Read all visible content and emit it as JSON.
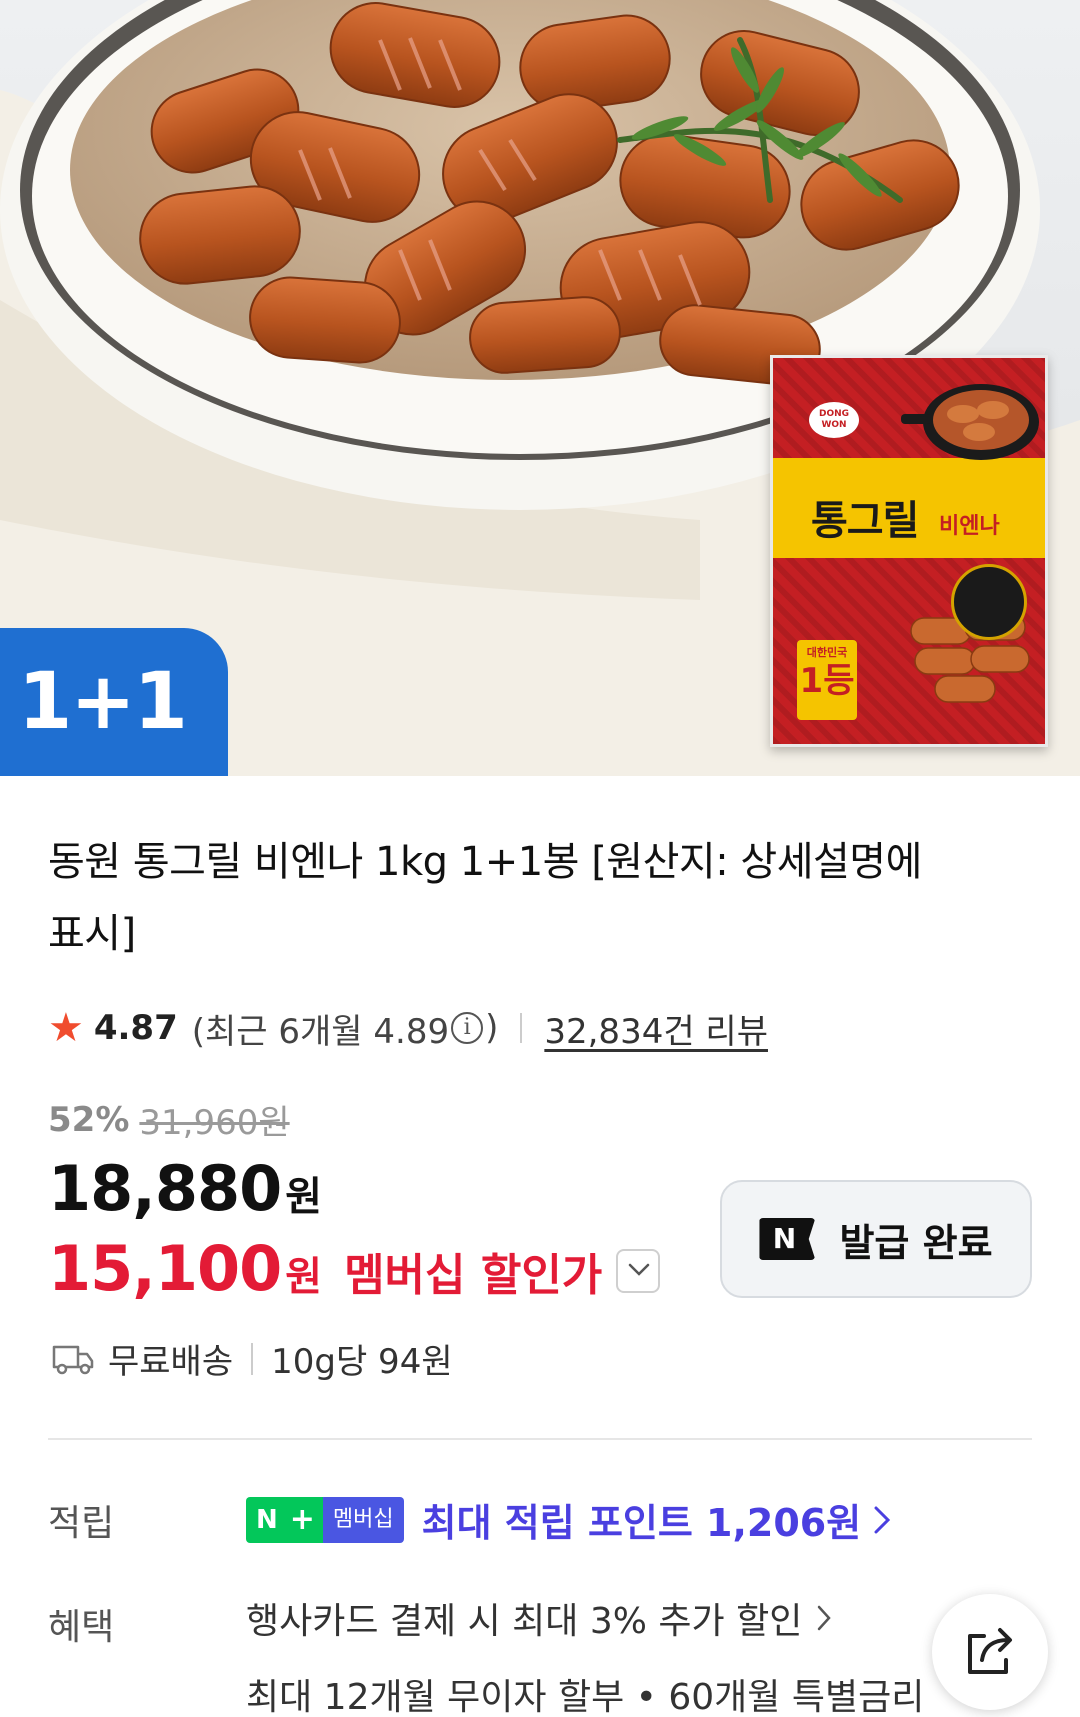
{
  "hero": {
    "badge": "1+1",
    "package": {
      "brand": "DONG WON",
      "title": "통그릴",
      "subtitle": "비엔나",
      "rank_top": "대한민국",
      "rank": "1등"
    }
  },
  "product": {
    "title": "동원 통그릴 비엔나 1kg 1+1봉 [원산지: 상세설명에 표시]"
  },
  "rating": {
    "score": "4.87",
    "recent": "(최근 6개월 4.89",
    "recent_close": ")",
    "info_glyph": "i",
    "reviews": "32,834건 리뷰"
  },
  "price": {
    "discount": "52%",
    "original": "31,960원",
    "sale": "18,880",
    "sale_unit": "원",
    "member": "15,100",
    "member_unit": "원",
    "member_label": "멤버십 할인가"
  },
  "coupon": {
    "logo": "N",
    "label": "발급 완료"
  },
  "shipping": {
    "label": "무료배송",
    "unit_price": "10g당 94원"
  },
  "points": {
    "label": "적립",
    "badge_n": "N",
    "badge_plus": "+",
    "badge_member": "멤버십",
    "text": "최대 적립 포인트 1,206원"
  },
  "benefits": {
    "label": "혜택",
    "line1": "행사카드 결제 시 최대 3% 추가 할인",
    "line2": "최대 12개월 무이자 할부 • 60개월 특별금리"
  },
  "colors": {
    "badge_blue": "#1f6fd1",
    "member_red": "#e31b36",
    "points_purple": "#4a3fe0",
    "naver_green": "#03c75a",
    "star": "#f04c2e"
  }
}
